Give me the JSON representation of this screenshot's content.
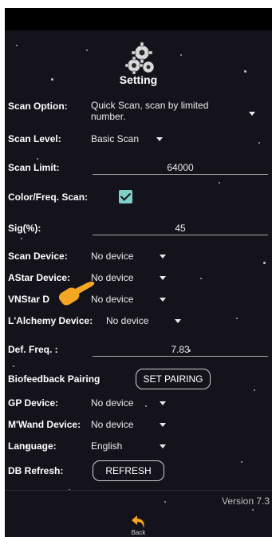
{
  "header": {
    "title": "Setting",
    "icon": "gears-icon"
  },
  "settings": {
    "scan_option": {
      "label": "Scan Option:",
      "value": "Quick Scan, scan by limited number."
    },
    "scan_level": {
      "label": "Scan Level:",
      "value": "Basic Scan"
    },
    "scan_limit": {
      "label": "Scan Limit:",
      "value": "64000"
    },
    "color_freq_scan": {
      "label": "Color/Freq. Scan:",
      "checked": true
    },
    "sig": {
      "label": "Sig(%):",
      "value": "45"
    },
    "scan_device": {
      "label": "Scan Device:",
      "value": "No device"
    },
    "astar_device": {
      "label": "AStar Device:",
      "value": "No device"
    },
    "vnstar_device": {
      "label": "VNStar Device:",
      "label_visible": "VNStar D",
      "label_tail": ":",
      "value": "No device"
    },
    "lalchemy_device": {
      "label": "L'Alchemy Device:",
      "value": "No device"
    },
    "def_freq": {
      "label": "Def. Freq. :",
      "value": "7.83"
    },
    "biofeedback": {
      "label": "Biofeedback Pairing",
      "button": "SET PAIRING"
    },
    "gp_device": {
      "label": "GP Device:",
      "value": "No device"
    },
    "mwand_device": {
      "label": "M'Wand Device:",
      "value": "No device"
    },
    "language": {
      "label": "Language:",
      "value": "English"
    },
    "db_refresh": {
      "label": "DB Refresh:",
      "button": "REFRESH"
    }
  },
  "footer": {
    "version": "Version 7.3",
    "back_label": "Back",
    "back_icon": "back-arrow-icon"
  },
  "overlay": {
    "icon": "pointing-hand-icon",
    "color": "#f5a623"
  },
  "colors": {
    "background": "#14131c",
    "checkbox": "#7dd0c8",
    "accent_orange": "#f5a623"
  }
}
